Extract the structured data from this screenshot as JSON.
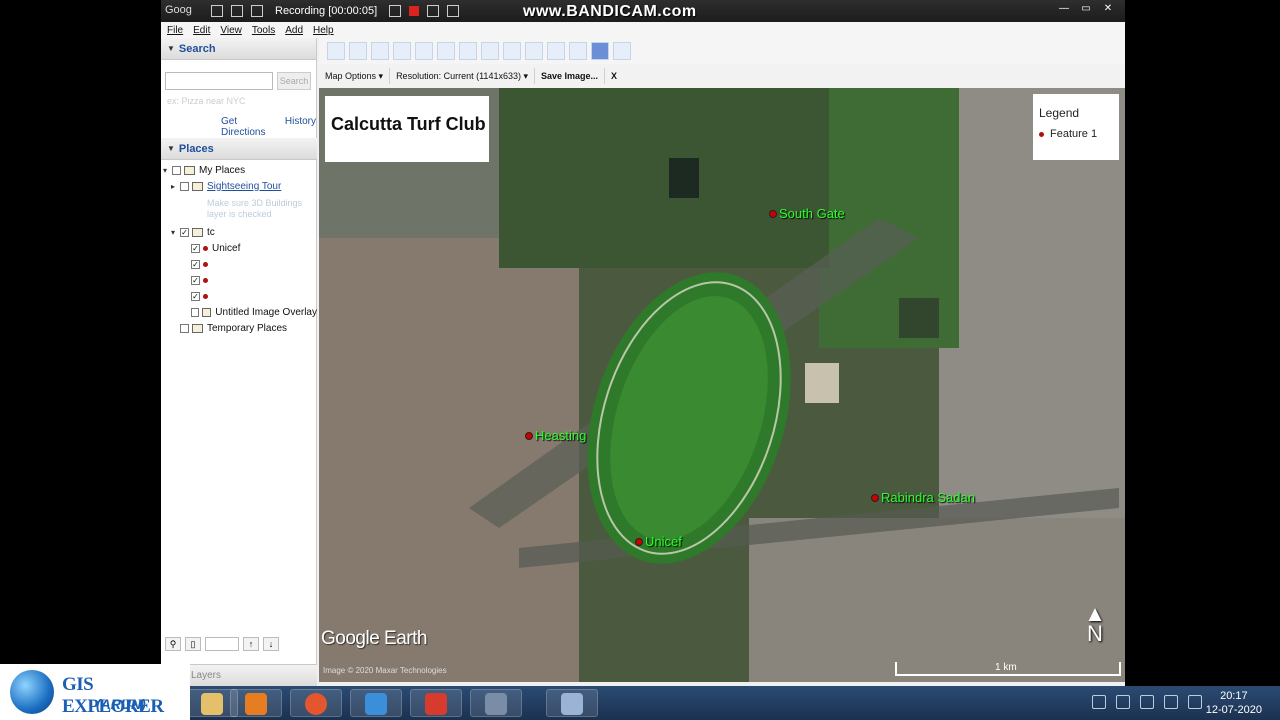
{
  "titlebar": {
    "app_name": "Goog",
    "recording": "Recording [00:00:05]",
    "watermark": "www.BANDICAM.com",
    "win_buttons": [
      "—",
      "▭",
      "✕"
    ]
  },
  "menu": [
    "File",
    "Edit",
    "View",
    "Tools",
    "Add",
    "Help"
  ],
  "sidebar": {
    "search_header": "Search",
    "search_button": "Search",
    "links": [
      "Get Directions",
      "History"
    ],
    "places_header": "Places",
    "tree": {
      "my_places": "My Places",
      "sightseeing": "Sightseeing Tour",
      "sightseeing_note": "Make sure 3D Buildings layer is checked",
      "folder_name": "tc",
      "item_1": "Unicef",
      "overlay": "Untitled Image Overlay",
      "temporary": "Temporary Places"
    },
    "layers_header": "Layers"
  },
  "toolbar_icons": [
    "sidebar-toggle-icon",
    "placemark-icon",
    "polygon-icon",
    "path-icon",
    "image-overlay-icon",
    "record-tour-icon",
    "historical-imagery-icon",
    "sun-icon",
    "planets-icon",
    "ruler-icon",
    "email-icon",
    "print-icon",
    "save-image-icon",
    "maps-icon"
  ],
  "option_bar": {
    "map_options": "Map Options",
    "resolution": "Resolution: Current (1141x633)",
    "save_image": "Save Image...",
    "close": "X"
  },
  "map": {
    "title": "Calcutta Turf Club",
    "legend_title": "Legend",
    "legend_item": "Feature 1",
    "placemarks": [
      "South Gate",
      "Heasting",
      "Rabindra Sadan",
      "Unicef"
    ],
    "brand": "Google Earth",
    "imagery": "Image © 2020 Maxar Technologies",
    "scale": "1 km",
    "north": "N"
  },
  "taskbar": {
    "time": "20:17",
    "date": "12-07-2020"
  },
  "logo": {
    "title": "GIS EXPLORER",
    "subtitle": "(ARUN)"
  }
}
